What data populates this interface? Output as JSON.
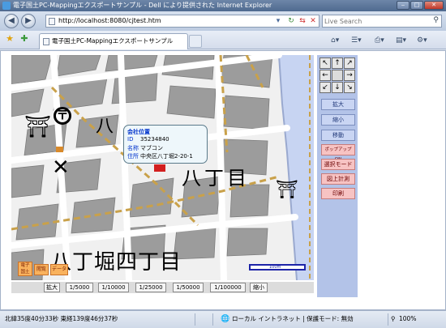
{
  "window": {
    "title": "電子国土PC-Mappingエクスポートサンプル - Dell により提供された Internet Explorer",
    "buttons": {
      "minimize": "‒",
      "maximize": "□",
      "close": "✕"
    }
  },
  "address_bar": {
    "url": "http://localhost:8080/cjtest.htm",
    "search_placeholder": "Live Search"
  },
  "tabs": [
    {
      "label": "電子国土PC-Mappingエクスポートサンプル"
    }
  ],
  "map": {
    "labels": {
      "hacchobori_3": "八丁目",
      "hacchobori_4": "八丁堀四丁目",
      "shrine_left": "⛩",
      "shrine_right": "⛩"
    },
    "balloon": {
      "title": "会社位置",
      "rows": [
        {
          "key": "ID",
          "value": "35234840"
        },
        {
          "key": "名称",
          "value": "マブコン"
        },
        {
          "key": "住所",
          "value": "中央区八丁堀2-20-1"
        }
      ]
    },
    "scale_label": "100m",
    "overlay_buttons": [
      "電子国土",
      "閲覧",
      "データ"
    ]
  },
  "right_panel": {
    "arrows": [
      "↖",
      "↑",
      "↗",
      "←",
      "",
      "→",
      "↙",
      "↓",
      "↘"
    ],
    "zoom_in": "拡大",
    "zoom_out": "縮小",
    "pan": "移動",
    "popup_toggle": "ポップアップON",
    "select_mode": "選択モード",
    "measure": "図上計測",
    "print": "印刷"
  },
  "scale_buttons": [
    "拡大",
    "1/5000",
    "1/10000",
    "1/25000",
    "1/50000",
    "1/100000",
    "縮小"
  ],
  "status_bar": {
    "coords": "北緯35度40分33秒 東経139度46分37秒",
    "zone": "ローカル イントラネット | 保護モード: 無効",
    "zoom": "100%"
  }
}
